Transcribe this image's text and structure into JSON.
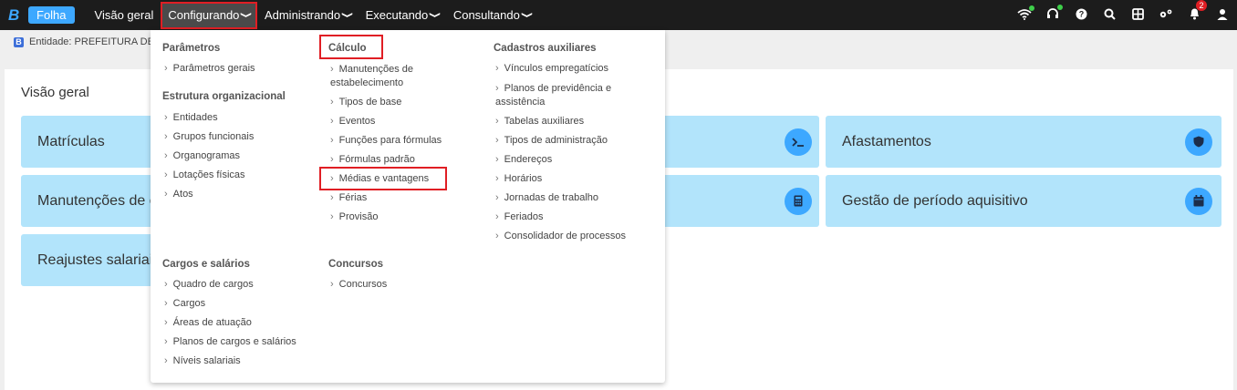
{
  "app": {
    "brand_letter": "B",
    "name": "Folha"
  },
  "nav": [
    {
      "label": "Visão geral",
      "chevron": ""
    },
    {
      "label": "Configurando",
      "chevron": "❯"
    },
    {
      "label": "Administrando",
      "chevron": "❯"
    },
    {
      "label": "Executando",
      "chevron": "❯"
    },
    {
      "label": "Consultando",
      "chevron": "❯"
    }
  ],
  "topbar_icons": [
    "wifi-icon",
    "headset-icon",
    "help-icon",
    "search-icon",
    "grid-icon",
    "settings-icon",
    "notifications-icon",
    "user-icon"
  ],
  "notifications_count": "2",
  "entity": {
    "icon_letter": "B",
    "label": "Entidade: PREFEITURA DE D"
  },
  "overview": {
    "title": "Visão geral",
    "cards": [
      {
        "label": "Matrículas",
        "icon": "terminal-icon"
      },
      {
        "label": "Afastamentos",
        "icon": "shield-icon"
      },
      {
        "label": "Manutenções de e",
        "icon": "calculator-icon"
      },
      {
        "label": "Gestão de período aquisitivo",
        "icon": "calendar-icon"
      },
      {
        "label": "Reajustes salariais"
      }
    ]
  },
  "menu": {
    "col1": {
      "sections": [
        {
          "title": "Parâmetros",
          "items": [
            "Parâmetros gerais"
          ]
        },
        {
          "title": "Estrutura organizacional",
          "items": [
            "Entidades",
            "Grupos funcionais",
            "Organogramas",
            "Lotações físicas",
            "Atos"
          ]
        },
        {
          "title": "Cargos e salários",
          "items": [
            "Quadro de cargos",
            "Cargos",
            "Áreas de atuação",
            "Planos de cargos e salários",
            "Níveis salariais"
          ]
        }
      ]
    },
    "col2": {
      "sections": [
        {
          "title": "Cálculo",
          "items": [
            "Manutenções de",
            "estabelecimento",
            "Tipos de base",
            "Eventos",
            "Funções para fórmulas",
            "Fórmulas padrão",
            "Médias e vantagens",
            "Férias",
            "Provisão"
          ]
        },
        {
          "title": "Concursos",
          "items": [
            "Concursos"
          ]
        }
      ]
    },
    "col3": {
      "sections": [
        {
          "title": "Cadastros auxiliares",
          "items": [
            "Vínculos empregatícios",
            "Planos de previdência e",
            "assistência",
            "Tabelas auxiliares",
            "Tipos de administração",
            "Endereços",
            "Horários",
            "Jornadas de trabalho",
            "Feriados",
            "Consolidador de processos"
          ]
        }
      ]
    },
    "arrow": "›"
  },
  "colors": {
    "topbar": "#1c1c1c",
    "accent": "#3da8ff",
    "card": "#b2e4fb",
    "highlight": "#e01e24"
  }
}
